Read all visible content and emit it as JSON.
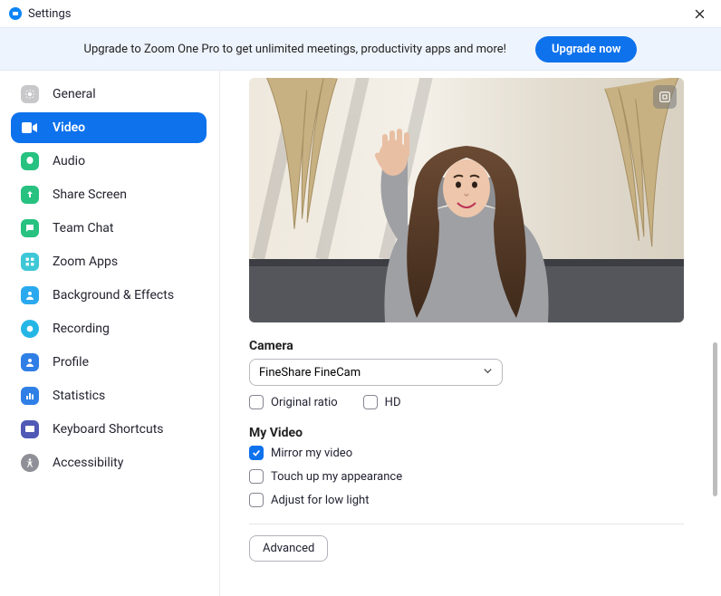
{
  "window": {
    "title": "Settings"
  },
  "banner": {
    "text": "Upgrade to Zoom One Pro to get unlimited meetings, productivity apps and more!",
    "button": "Upgrade now"
  },
  "sidebar": {
    "items": [
      {
        "label": "General",
        "icon": "gear",
        "color": "#c8c8ca",
        "active": false
      },
      {
        "label": "Video",
        "icon": "video",
        "color": "#ffffff",
        "active": true
      },
      {
        "label": "Audio",
        "icon": "audio",
        "color": "#27c180",
        "active": false
      },
      {
        "label": "Share Screen",
        "icon": "share",
        "color": "#27c180",
        "active": false
      },
      {
        "label": "Team Chat",
        "icon": "chat",
        "color": "#27c180",
        "active": false
      },
      {
        "label": "Zoom Apps",
        "icon": "apps",
        "color": "#3ec7d6",
        "active": false
      },
      {
        "label": "Background & Effects",
        "icon": "bg",
        "color": "#2aa9ef",
        "active": false
      },
      {
        "label": "Recording",
        "icon": "record",
        "color": "#25b6e6",
        "active": false
      },
      {
        "label": "Profile",
        "icon": "profile",
        "color": "#2f7fe6",
        "active": false
      },
      {
        "label": "Statistics",
        "icon": "stats",
        "color": "#2f7fe6",
        "active": false
      },
      {
        "label": "Keyboard Shortcuts",
        "icon": "keyboard",
        "color": "#5059b5",
        "active": false
      },
      {
        "label": "Accessibility",
        "icon": "accessibility",
        "color": "#8f8f97",
        "active": false
      }
    ]
  },
  "main": {
    "camera": {
      "label": "Camera",
      "selected": "FineShare FineCam",
      "checkboxes": [
        {
          "label": "Original ratio",
          "checked": false
        },
        {
          "label": "HD",
          "checked": false
        }
      ]
    },
    "myvideo": {
      "label": "My Video",
      "checkboxes": [
        {
          "label": "Mirror my video",
          "checked": true
        },
        {
          "label": "Touch up my appearance",
          "checked": false
        },
        {
          "label": "Adjust for low light",
          "checked": false
        }
      ]
    },
    "advanced_button": "Advanced"
  }
}
